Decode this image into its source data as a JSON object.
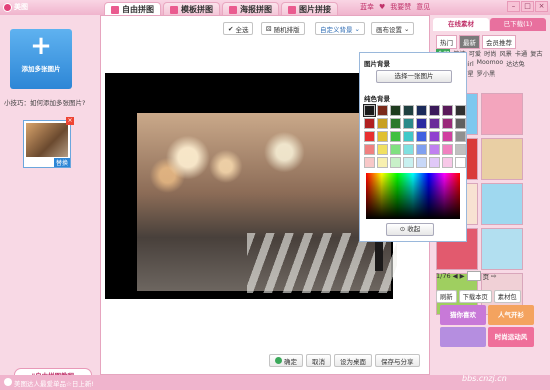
{
  "window": {
    "title": "美图",
    "user": "蓝幸",
    "favorite": "我要赞",
    "help": "意见"
  },
  "tabs": [
    {
      "label": "自由拼图"
    },
    {
      "label": "模板拼图"
    },
    {
      "label": "海报拼图"
    },
    {
      "label": "图片拼接"
    }
  ],
  "left": {
    "add_label": "添加多张图片",
    "tip": "小技巧：如何添加多张图片?",
    "thumb_label": "替换",
    "tutorial": "\"自由拼图教程"
  },
  "toolbar": {
    "select_all": "全选",
    "random_layout": "随机排版",
    "custom_bg": "自定义背景",
    "canvas_settings": "画布设置"
  },
  "bg_popup": {
    "image_bg_heading": "图片背景",
    "choose_image": "选择一张图片",
    "solid_bg_heading": "纯色背景",
    "collapse": "收起",
    "swatch_colors": [
      "#1a1a1a",
      "#7a2a1a",
      "#1f3c1f",
      "#1f4040",
      "#1a2a5a",
      "#3a1a5a",
      "#5a1a5a",
      "#303030",
      "#b02020",
      "#c8a020",
      "#2a7a2a",
      "#2a8a8a",
      "#2a2aa0",
      "#6a2a9a",
      "#9a2a7a",
      "#606060",
      "#e83030",
      "#e0c030",
      "#40c040",
      "#40c8c8",
      "#4060e0",
      "#9040d0",
      "#d040a0",
      "#909090",
      "#f08080",
      "#f0e060",
      "#80e080",
      "#80e0e0",
      "#80a0f0",
      "#c080f0",
      "#f080c0",
      "#c0c0c0",
      "#f8c8c8",
      "#f8f0b0",
      "#c8f0c8",
      "#c8f0f0",
      "#c8d8f8",
      "#e0c8f8",
      "#f8c8e8",
      "#ffffff"
    ]
  },
  "bottom_buttons": {
    "ok": "确定",
    "cancel": "取消",
    "set_desktop": "设为桌面",
    "save_share": "保存与分享"
  },
  "right": {
    "tabs": [
      {
        "label": "在线素材"
      },
      {
        "label": "已下载(1)"
      }
    ],
    "subtabs": [
      {
        "label": "热门"
      },
      {
        "label": "最新"
      },
      {
        "label": "会员推荐"
      }
    ],
    "categories": [
      "全部",
      "简洁",
      "可爱",
      "时尚",
      "风景",
      "卡通",
      "复古",
      "超萌",
      "时尚girl",
      "Moomoo",
      "达达兔",
      "水雷girl",
      "阿星",
      "罗小黑"
    ],
    "template_colors": [
      "#7ec8ef",
      "#f3a5bd",
      "#d93a3a",
      "#e9cfa4",
      "#f8e2d2",
      "#9fd8ef",
      "#e25a6e",
      "#b2dff0",
      "#9fcf60",
      "#f0d0d6"
    ],
    "page": "1/76",
    "page_go": "页",
    "refresh": "刷新",
    "download_page": "下载本页",
    "material_pack": "素材包",
    "stickers": [
      {
        "label": "猫你喜欢",
        "color": "#c879d8"
      },
      {
        "label": "人气开衫",
        "color": "#f4a35f"
      },
      {
        "label": "",
        "color": "#b58ee0"
      },
      {
        "label": "时尚运动风",
        "color": "#ef6f9a"
      }
    ]
  },
  "status": {
    "text": "美图达人最爱单品☆日上新!",
    "watermark": "bbs.cnzj.cn"
  }
}
